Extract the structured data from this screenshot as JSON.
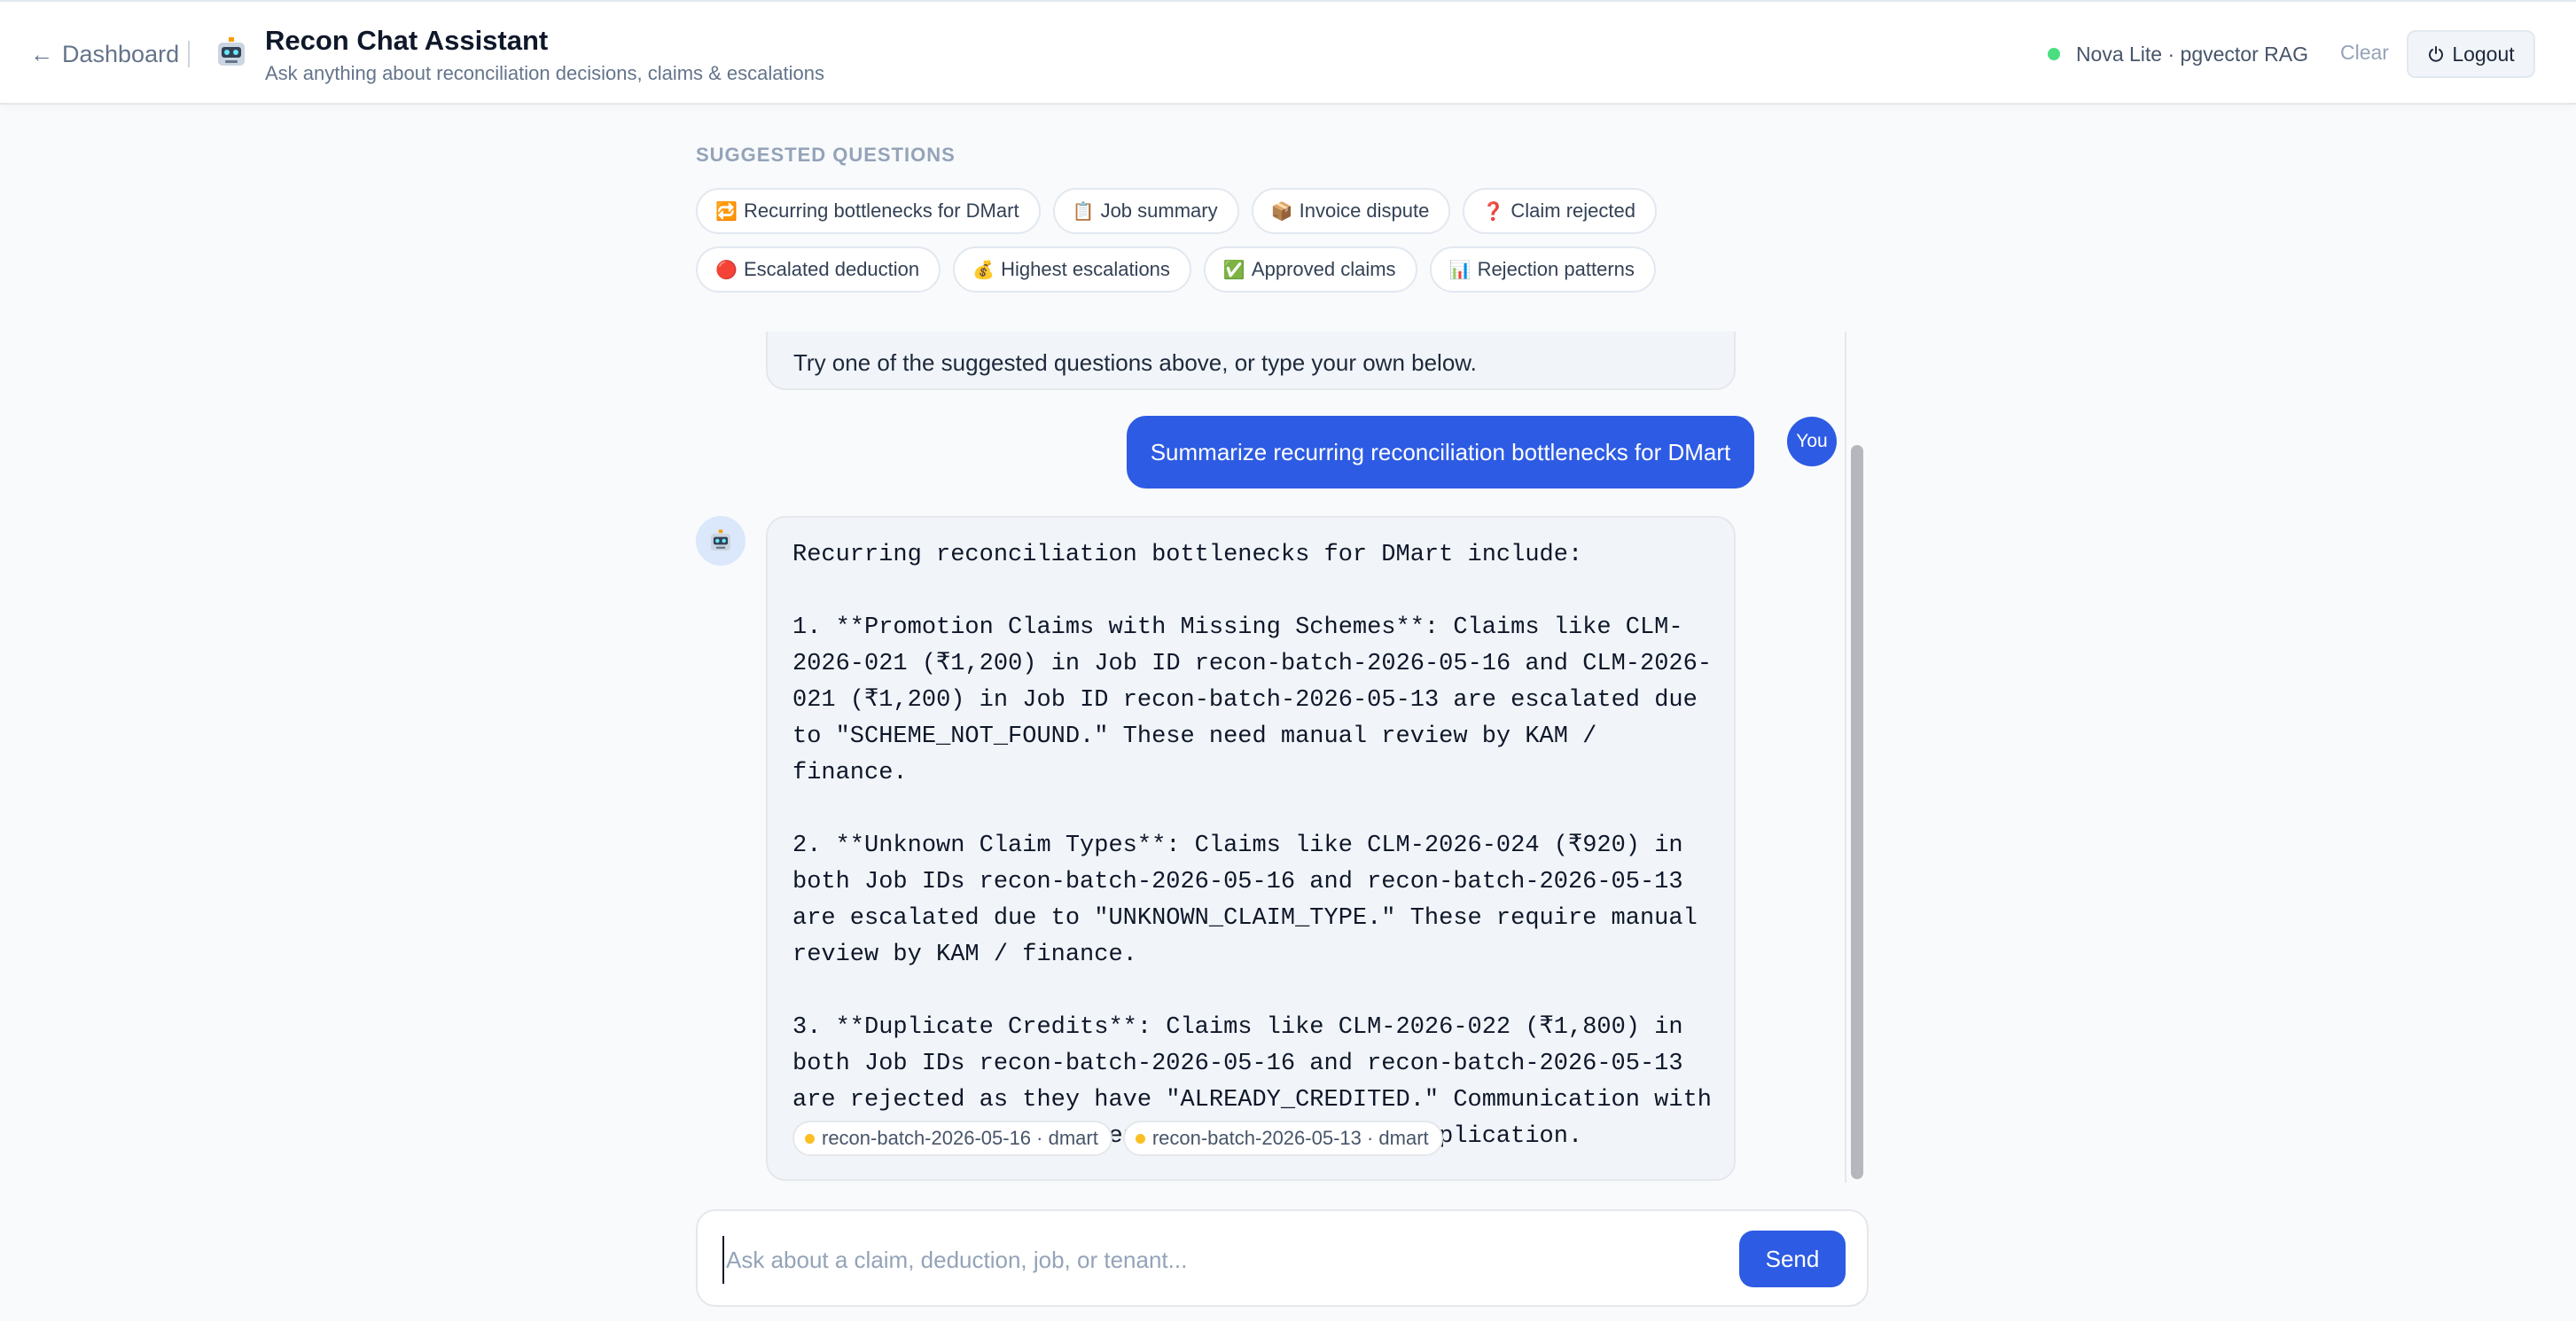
{
  "header": {
    "back_label": "Dashboard",
    "title": "Recon Chat Assistant",
    "subtitle": "Ask anything about reconciliation decisions, claims & escalations",
    "status_text": "Nova Lite · pgvector RAG",
    "clear_label": "Clear",
    "logout_label": "Logout"
  },
  "suggestions": {
    "label": "SUGGESTED QUESTIONS",
    "row1": [
      {
        "icon": "🔁",
        "label": "Recurring bottlenecks for DMart"
      },
      {
        "icon": "📋",
        "label": "Job summary"
      },
      {
        "icon": "📦",
        "label": "Invoice dispute"
      },
      {
        "icon": "❓",
        "label": "Claim rejected"
      }
    ],
    "row2": [
      {
        "icon": "🔴",
        "label": "Escalated deduction"
      },
      {
        "icon": "💰",
        "label": "Highest escalations"
      },
      {
        "icon": "✅",
        "label": "Approved claims"
      },
      {
        "icon": "📊",
        "label": "Rejection patterns"
      }
    ]
  },
  "chat": {
    "intro_text": "Try one of the suggested questions above, or type your own below.",
    "user_avatar_label": "You",
    "user_message": "Summarize recurring reconciliation bottlenecks for DMart",
    "bot_message": "Recurring reconciliation bottlenecks for DMart include:\n\n1. **Promotion Claims with Missing Schemes**: Claims like CLM-2026-021 (₹1,200) in Job ID recon-batch-2026-05-16 and CLM-2026-021 (₹1,200) in Job ID recon-batch-2026-05-13 are escalated due to \"SCHEME_NOT_FOUND.\" These need manual review by KAM / finance.\n\n2. **Unknown Claim Types**: Claims like CLM-2026-024 (₹920) in both Job IDs recon-batch-2026-05-16 and recon-batch-2026-05-13 are escalated due to \"UNKNOWN_CLAIM_TYPE.\" These require manual review by KAM / finance.\n\n3. **Duplicate Credits**: Claims like CLM-2026-022 (₹1,800) in both Job IDs recon-batch-2026-05-16 and recon-batch-2026-05-13 are rejected as they have \"ALREADY_CREDITED.\" Communication with the retailer is recommended to address the duplication.",
    "sources": [
      "recon-batch-2026-05-16 · dmart",
      "recon-batch-2026-05-13 · dmart"
    ]
  },
  "composer": {
    "placeholder": "Ask about a claim, deduction, job, or tenant...",
    "send_label": "Send"
  },
  "colors": {
    "accent": "#2d5be3",
    "status_online": "#4ade80",
    "source_dot": "#fbbf24"
  },
  "icons": {
    "back": "arrow-left-icon",
    "app": "robot-icon",
    "logout": "power-icon"
  }
}
